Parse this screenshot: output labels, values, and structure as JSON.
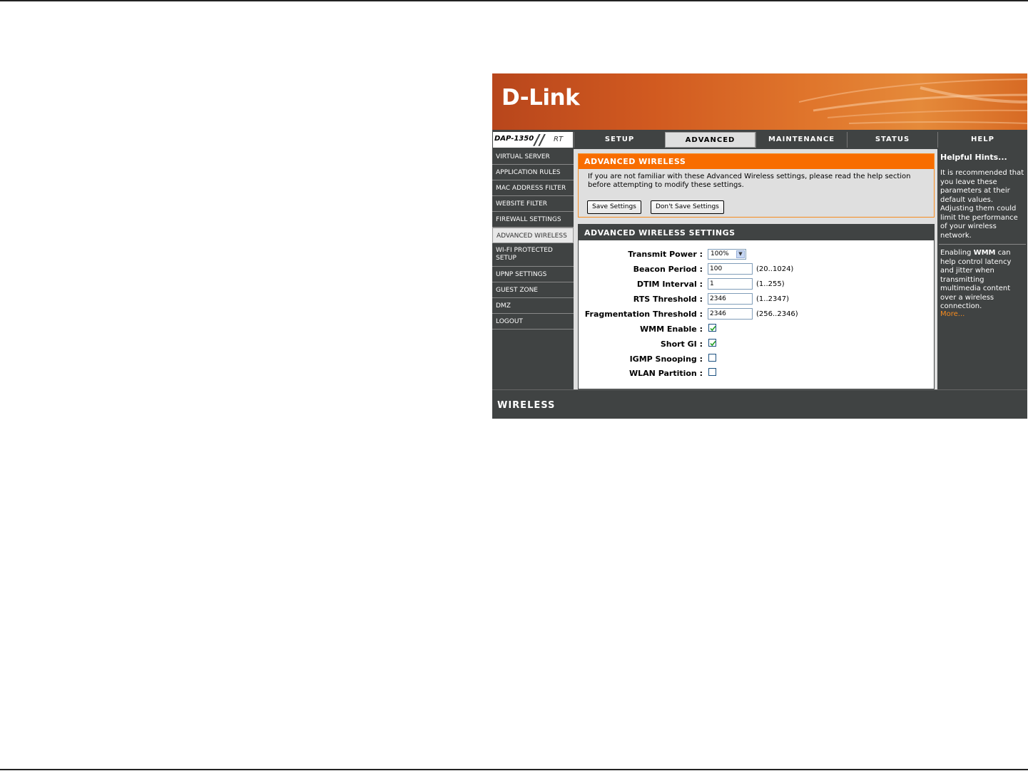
{
  "brand": {
    "logo": "D-Link",
    "model": "DAP-1350",
    "model_suffix": "RT",
    "footer": "WIRELESS"
  },
  "tabs": [
    {
      "label": "SETUP",
      "active": false
    },
    {
      "label": "ADVANCED",
      "active": true
    },
    {
      "label": "MAINTENANCE",
      "active": false
    },
    {
      "label": "STATUS",
      "active": false
    },
    {
      "label": "HELP",
      "active": false
    }
  ],
  "sidebar": {
    "items": [
      {
        "label": "VIRTUAL SERVER"
      },
      {
        "label": "APPLICATION RULES"
      },
      {
        "label": "MAC ADDRESS FILTER"
      },
      {
        "label": "WEBSITE FILTER"
      },
      {
        "label": "FIREWALL SETTINGS"
      },
      {
        "label": "ADVANCED WIRELESS",
        "active": true
      },
      {
        "label": "WI-FI PROTECTED SETUP"
      },
      {
        "label": "UPNP SETTINGS"
      },
      {
        "label": "GUEST ZONE"
      },
      {
        "label": "DMZ"
      },
      {
        "label": "LOGOUT"
      }
    ]
  },
  "intro": {
    "title": "ADVANCED WIRELESS",
    "message": "If you are not familiar with these Advanced Wireless settings, please read the help section before attempting to modify these settings.",
    "save_label": "Save Settings",
    "dont_save_label": "Don't Save Settings"
  },
  "settings": {
    "title": "ADVANCED WIRELESS SETTINGS",
    "transmit_power": {
      "label": "Transmit Power :",
      "value": "100%"
    },
    "beacon_period": {
      "label": "Beacon Period :",
      "value": "100",
      "range": "(20..1024)"
    },
    "dtim_interval": {
      "label": "DTIM Interval :",
      "value": "1",
      "range": "(1..255)"
    },
    "rts_threshold": {
      "label": "RTS Threshold :",
      "value": "2346",
      "range": "(1..2347)"
    },
    "frag_threshold": {
      "label": "Fragmentation Threshold :",
      "value": "2346",
      "range": "(256..2346)"
    },
    "wmm_enable": {
      "label": "WMM Enable :",
      "checked": true
    },
    "short_gi": {
      "label": "Short GI :",
      "checked": true
    },
    "igmp_snooping": {
      "label": "IGMP Snooping :",
      "checked": false
    },
    "wlan_partition": {
      "label": "WLAN Partition :",
      "checked": false
    }
  },
  "help": {
    "title": "Helpful Hints...",
    "para1": "It is recommended that you leave these parameters at their default values. Adjusting them could limit the performance of your wireless network.",
    "para2_prefix": "Enabling ",
    "para2_bold": "WMM",
    "para2_suffix": " can help control latency and jitter when transmitting multimedia content over a wireless connection.",
    "more": "More..."
  }
}
